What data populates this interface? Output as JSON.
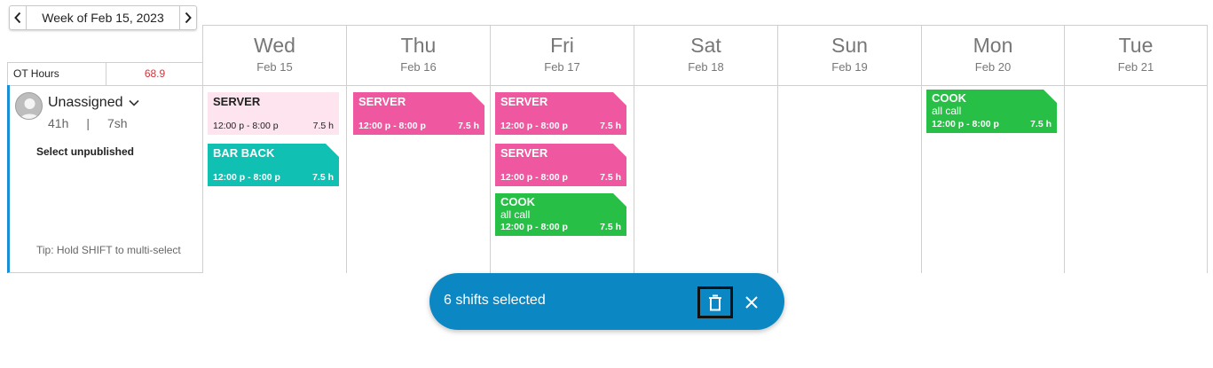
{
  "week_nav": {
    "label": "Week of Feb 15, 2023",
    "prev_icon": "chevron-left-icon",
    "next_icon": "chevron-right-icon"
  },
  "ot": {
    "label": "OT Hours",
    "value": "68.9",
    "value_color": "#d0353e"
  },
  "days": [
    {
      "name": "Wed",
      "date": "Feb 15"
    },
    {
      "name": "Thu",
      "date": "Feb 16"
    },
    {
      "name": "Fri",
      "date": "Feb 17"
    },
    {
      "name": "Sat",
      "date": "Feb 18"
    },
    {
      "name": "Sun",
      "date": "Feb 19"
    },
    {
      "name": "Mon",
      "date": "Feb 20"
    },
    {
      "name": "Tue",
      "date": "Feb 21"
    }
  ],
  "employee": {
    "name": "Unassigned",
    "hours": "41h",
    "separator": "|",
    "shift_hours": "7sh",
    "select_unpublished": "Select unpublished",
    "tip": "Tip: Hold SHIFT to multi-select",
    "accent_color": "#1a8fd6"
  },
  "shifts": {
    "wed_server": {
      "role": "SERVER",
      "time": "12:00 p - 8:00 p",
      "duration": "7.5 h",
      "color": "#fde4ee",
      "selected": false
    },
    "wed_barback": {
      "role": "BAR BACK",
      "time": "12:00 p - 8:00 p",
      "duration": "7.5 h",
      "color": "#10c1b3",
      "selected": true
    },
    "thu_server": {
      "role": "SERVER",
      "time": "12:00 p - 8:00 p",
      "duration": "7.5 h",
      "color": "#ef57a0",
      "selected": true
    },
    "fri_server1": {
      "role": "SERVER",
      "time": "12:00 p - 8:00 p",
      "duration": "7.5 h",
      "color": "#ef57a0",
      "selected": true
    },
    "fri_server2": {
      "role": "SERVER",
      "time": "12:00 p - 8:00 p",
      "duration": "7.5 h",
      "color": "#ef57a0",
      "selected": true
    },
    "fri_cook": {
      "role": "COOK",
      "note": "all call",
      "time": "12:00 p - 8:00 p",
      "duration": "7.5 h",
      "color": "#27bf45",
      "selected": true
    },
    "mon_cook": {
      "role": "COOK",
      "note": "all call",
      "time": "12:00 p - 8:00 p",
      "duration": "7.5 h",
      "color": "#27bf45",
      "selected": true
    }
  },
  "action_bar": {
    "count_label": "6 shifts selected",
    "delete_icon": "trash-icon",
    "close_icon": "close-icon",
    "color": "#0b87c3"
  }
}
